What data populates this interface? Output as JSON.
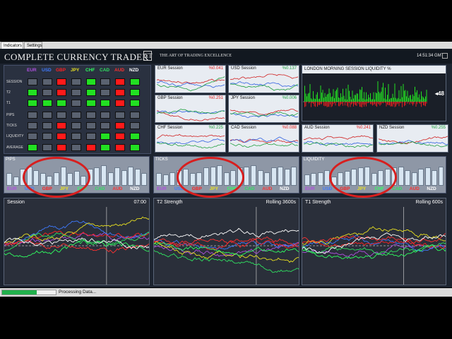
{
  "tabs": [
    {
      "label": "Indicators"
    },
    {
      "label": "Settings"
    }
  ],
  "header": {
    "brand": "COMPLETE CURRENCY TRADER",
    "tagline": "THE ART OF TRADING EXCELLENCE",
    "logo": "CT",
    "clock": "14:51:34 GMT"
  },
  "currencies": [
    "EUR",
    "USD",
    "GBP",
    "JPY",
    "CHF",
    "CAD",
    "AUD",
    "NZD"
  ],
  "currency_colors": {
    "EUR": "#b050e0",
    "USD": "#3f7bff",
    "GBP": "#ff2020",
    "JPY": "#e8e020",
    "CHF": "#30ff60",
    "CAD": "#30e060",
    "AUD": "#ff3030",
    "NZD": "#ffffff"
  },
  "grid": {
    "rows": [
      "SESSION",
      "T2",
      "T1",
      "PIPS",
      "TICKS",
      "LIQUIDITY",
      "AVERAGE"
    ],
    "cells": [
      [
        "gray",
        "gray",
        "red",
        "gray",
        "green",
        "gray",
        "red",
        "green"
      ],
      [
        "green",
        "gray",
        "red",
        "gray",
        "green",
        "gray",
        "red",
        "green"
      ],
      [
        "green",
        "green",
        "green",
        "gray",
        "green",
        "green",
        "red",
        "green"
      ],
      [
        "gray",
        "gray",
        "gray",
        "gray",
        "gray",
        "gray",
        "gray",
        "gray"
      ],
      [
        "gray",
        "gray",
        "red",
        "gray",
        "gray",
        "gray",
        "red",
        "gray"
      ],
      [
        "gray",
        "gray",
        "red",
        "gray",
        "gray",
        "green",
        "red",
        "green"
      ],
      [
        "green",
        "gray",
        "red",
        "gray",
        "red",
        "green",
        "red",
        "green"
      ]
    ],
    "cell_colors": {
      "gray": "#5a6270",
      "red": "#ff1a1a",
      "green": "#22e022"
    }
  },
  "sessions": [
    {
      "title": "EUR Session",
      "value": "%0.041",
      "value_color": "#e02020"
    },
    {
      "title": "USD Session",
      "value": "%0.137",
      "value_color": "#20a040"
    },
    {
      "title": "GBP Session",
      "value": "%0.251",
      "value_color": "#e02020"
    },
    {
      "title": "JPY Session",
      "value": "%0.006",
      "value_color": "#20a040"
    },
    {
      "title": "CHF Session",
      "value": "%0.225",
      "value_color": "#20a040"
    },
    {
      "title": "CAD Session",
      "value": "%0.088",
      "value_color": "#e02020"
    },
    {
      "title": "AUD Session",
      "value": "%0.241",
      "value_color": "#e02020"
    },
    {
      "title": "NZD Session",
      "value": "%0.255",
      "value_color": "#20a040"
    }
  ],
  "liquidity": {
    "title": "LONDON MORNING SESSION LIQUIDITY %",
    "value": "48"
  },
  "bar_panels": [
    {
      "title": "PIPS",
      "values": [
        0.55,
        0.4,
        0.75,
        0.85,
        0.7,
        0.55,
        0.45,
        0.6,
        0.85,
        0.55,
        0.65,
        0.45,
        0.75,
        0.8,
        0.9,
        0.6,
        0.8,
        0.7,
        0.85,
        0.75,
        0.55
      ]
    },
    {
      "title": "TICKS",
      "values": [
        0.55,
        0.5,
        0.6,
        0.7,
        0.75,
        0.55,
        0.6,
        0.8,
        0.85,
        0.9,
        0.6,
        0.7,
        0.8,
        0.85,
        0.9,
        0.7,
        0.6,
        0.8,
        0.85,
        0.75,
        0.85
      ]
    },
    {
      "title": "LIQUIDITY",
      "values": [
        0.5,
        0.55,
        0.6,
        0.7,
        0.4,
        0.6,
        0.65,
        0.75,
        0.8,
        0.85,
        0.55,
        0.7,
        0.75,
        0.8,
        0.85,
        0.7,
        0.6,
        0.75,
        0.8,
        0.7,
        0.85
      ]
    }
  ],
  "line_plots": [
    {
      "title": "Session",
      "right": "07:00"
    },
    {
      "title": "T2 Strength",
      "right": "Rolling 3600s"
    },
    {
      "title": "T1 Strength",
      "right": "Rolling 600s"
    }
  ],
  "status": {
    "text": "Processing Data...",
    "progress": 0.65
  }
}
